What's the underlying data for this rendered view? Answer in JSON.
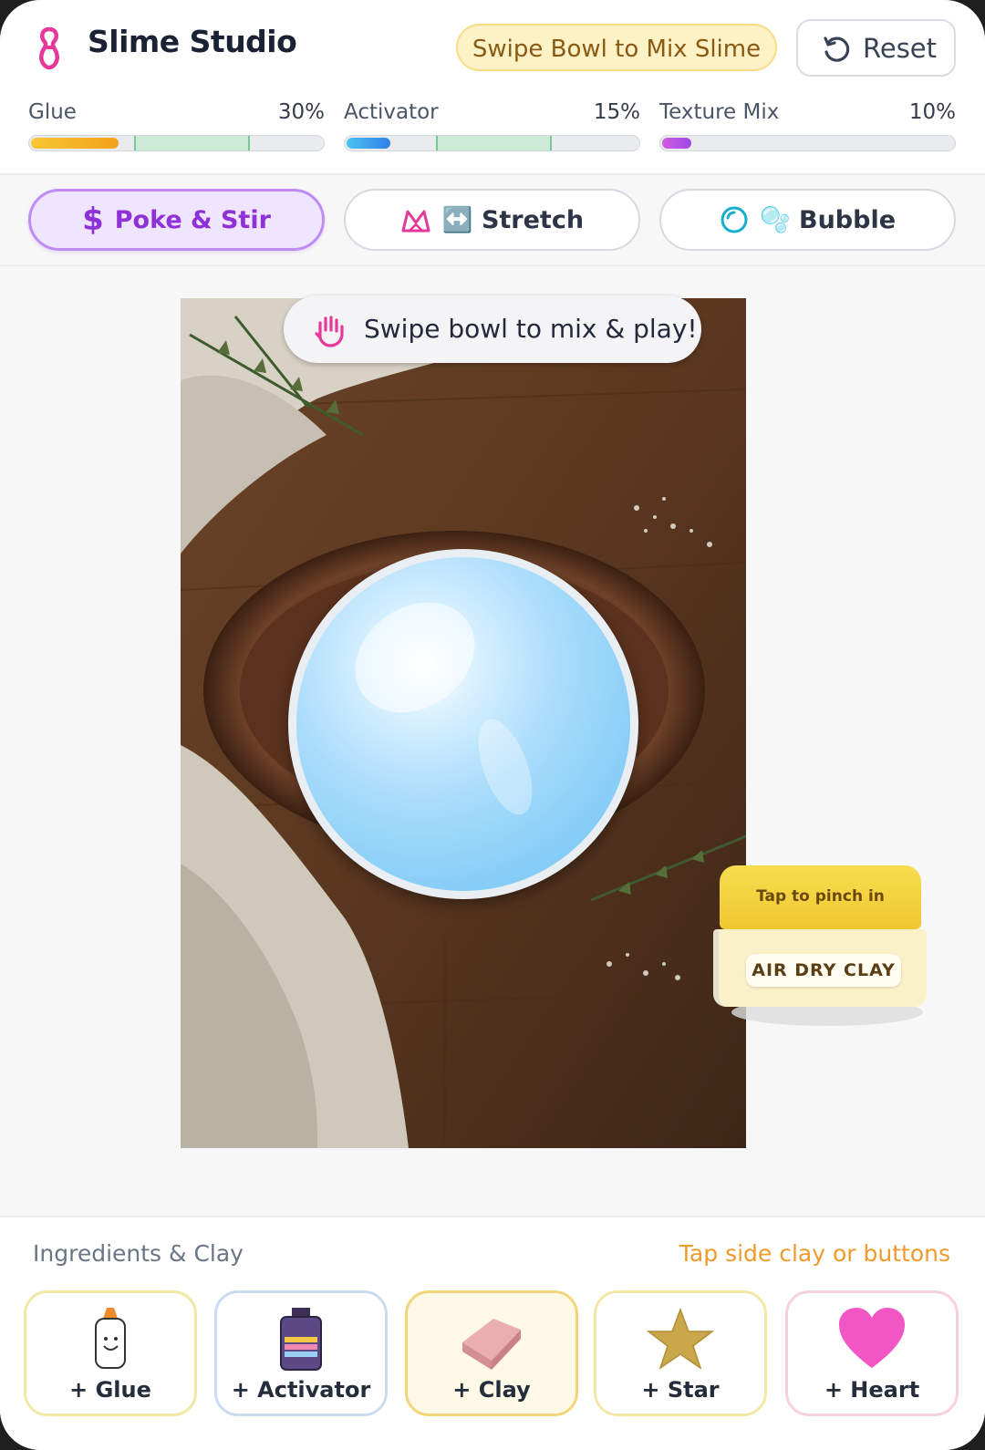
{
  "app": {
    "title": "Slime Studio",
    "instruction_pill": "Swipe Bowl to Mix Slime",
    "reset_label": "Reset"
  },
  "meters": [
    {
      "name": "Glue",
      "percent_label": "30%",
      "value": 0.3,
      "color": "#f5b21e"
    },
    {
      "name": "Activator",
      "percent_label": "15%",
      "value": 0.15,
      "color": "#2f9cf0"
    },
    {
      "name": "Texture Mix",
      "percent_label": "10%",
      "value": 0.1,
      "color": "#b454e8"
    }
  ],
  "modes": [
    {
      "label": "Poke & Stir",
      "icon": "dollar-icon",
      "active": true
    },
    {
      "label": "↔️ Stretch",
      "icon": "stretch-icon",
      "active": false
    },
    {
      "label": "🫧 Bubble",
      "icon": "bubble-icon",
      "active": false
    }
  ],
  "scene": {
    "hint": "Swipe bowl to mix & play!",
    "clay_tap_text": "Tap to pinch in",
    "clay_tag": "AIR DRY CLAY"
  },
  "ingredients": {
    "title": "Ingredients & Clay",
    "hint": "Tap side clay or buttons",
    "items": [
      {
        "label": "+ Glue",
        "icon": "glue-bottle-icon",
        "border": "#f3e7a6"
      },
      {
        "label": "+ Activator",
        "icon": "activator-bottle-icon",
        "border": "#c9dcf2"
      },
      {
        "label": "+ Clay",
        "icon": "clay-block-icon",
        "border": "#f1d77a",
        "bg": "#fef8e6"
      },
      {
        "label": "+ Star",
        "icon": "star-icon",
        "border": "#f3e7a6"
      },
      {
        "label": "+ Heart",
        "icon": "heart-icon",
        "border": "#f6d2df"
      }
    ]
  }
}
